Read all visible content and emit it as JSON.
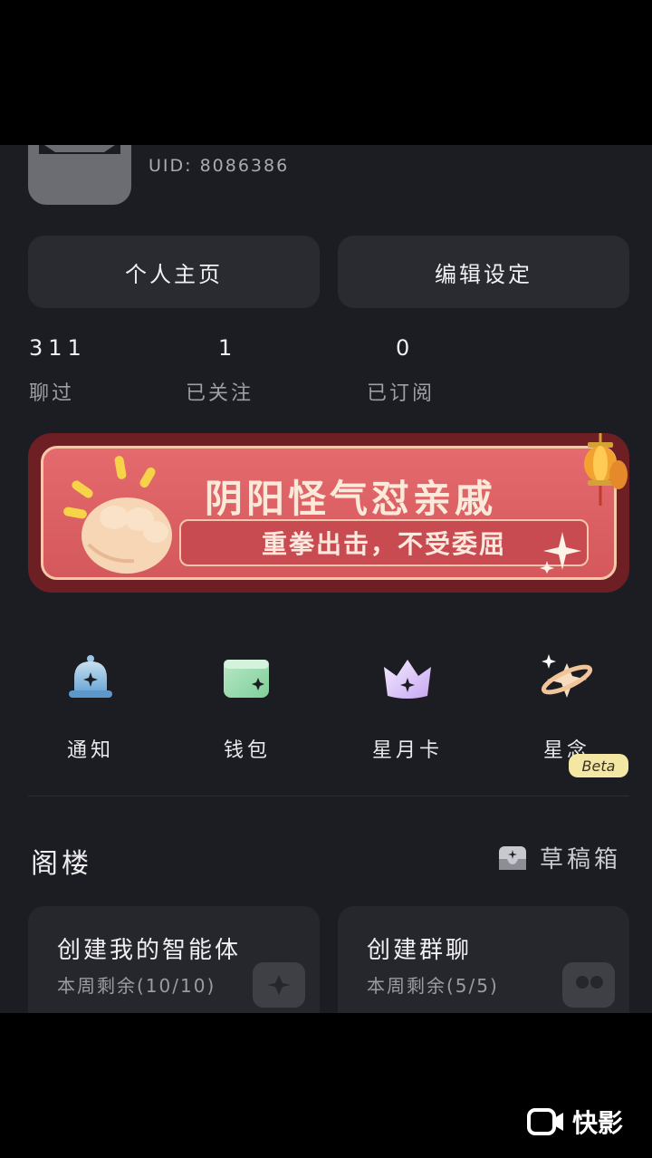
{
  "profile": {
    "uid": "UID: 8086386"
  },
  "actions": {
    "homepage": "个人主页",
    "edit": "编辑设定"
  },
  "stats": [
    {
      "value": "311",
      "label": "聊过"
    },
    {
      "value": "1",
      "label": "已关注"
    },
    {
      "value": "0",
      "label": "已订阅"
    }
  ],
  "banner": {
    "title": "阴阳怪气怼亲戚",
    "subtitle": "重拳出击，不受委屈"
  },
  "quick": [
    {
      "label": "通知",
      "icon": "bell-icon"
    },
    {
      "label": "钱包",
      "icon": "wallet-icon"
    },
    {
      "label": "星月卡",
      "icon": "crown-icon"
    },
    {
      "label": "星念",
      "icon": "star-wish-icon"
    }
  ],
  "section": {
    "title": "阁楼",
    "drafts": "草稿箱"
  },
  "cards": [
    {
      "title": "创建我的智能体",
      "sub": "本周剩余(10/10)"
    },
    {
      "title": "创建群聊",
      "sub": "本周剩余(5/5)",
      "badge": "Beta"
    }
  ],
  "watermark": "快影",
  "colors": {
    "background": "#1c1d22",
    "card": "#26272d",
    "banner": "#d4585c",
    "beta": "#f4e6a3"
  }
}
